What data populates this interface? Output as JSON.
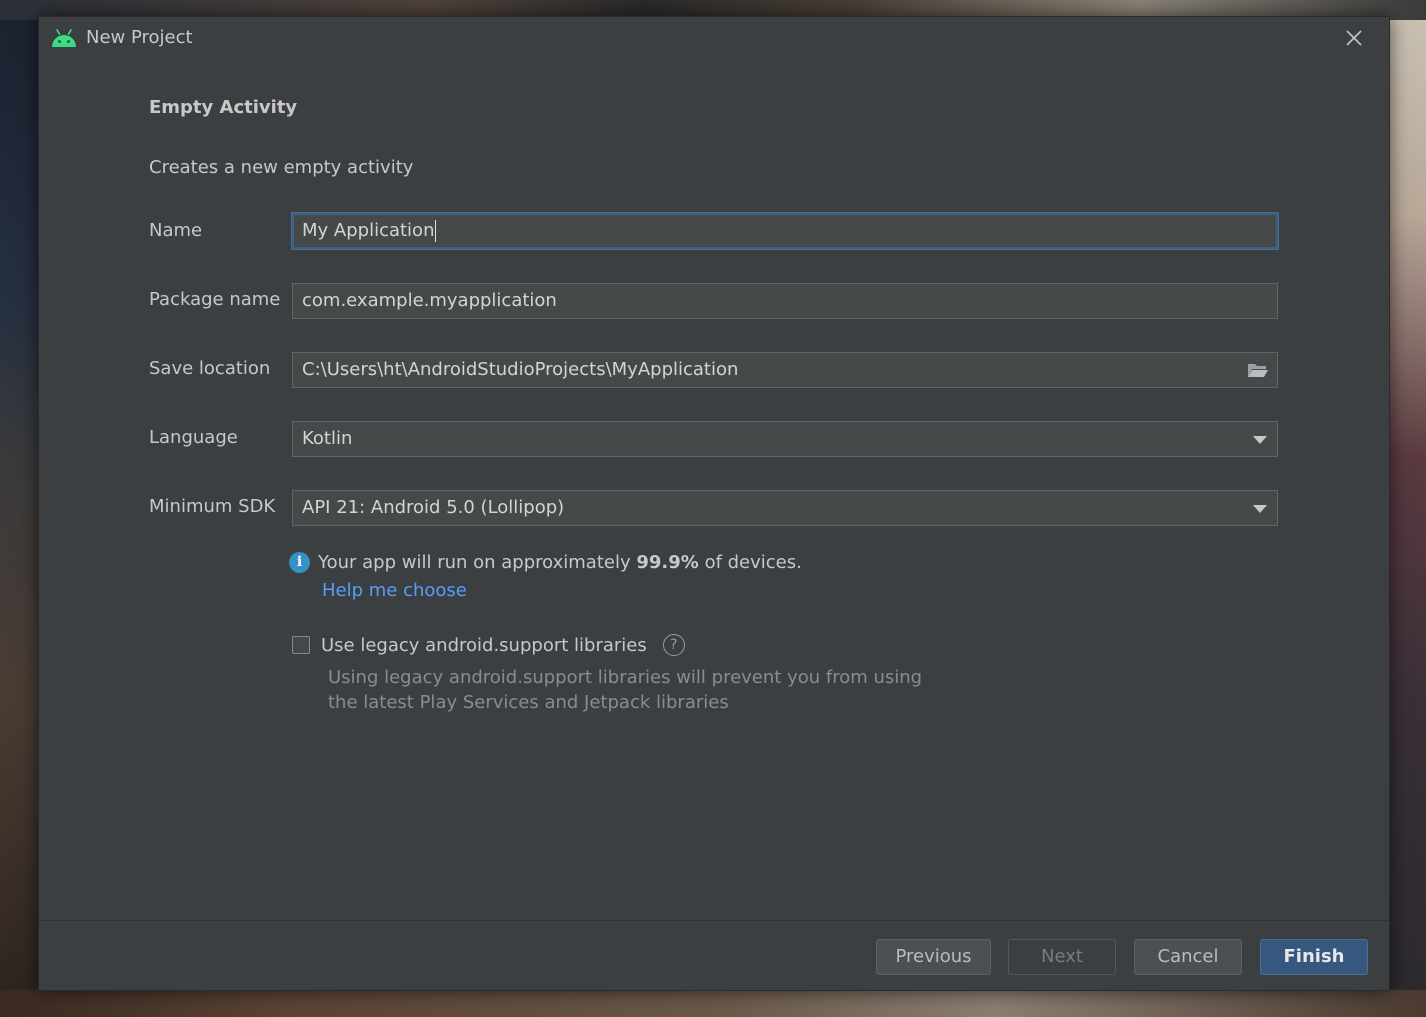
{
  "window": {
    "title": "New Project"
  },
  "template": {
    "heading": "Empty Activity",
    "description": "Creates a new empty activity"
  },
  "form": {
    "name_label": "Name",
    "name_value": "My Application",
    "package_label": "Package name",
    "package_value": "com.example.myapplication",
    "location_label": "Save location",
    "location_value": "C:\\Users\\ht\\AndroidStudioProjects\\MyApplication",
    "language_label": "Language",
    "language_value": "Kotlin",
    "sdk_label": "Minimum SDK",
    "sdk_value": "API 21: Android 5.0 (Lollipop)"
  },
  "info": {
    "prefix": "Your app will run on approximately",
    "percent": "99.9%",
    "suffix": "of devices.",
    "help_link": "Help me choose"
  },
  "legacy": {
    "label": "Use legacy android.support libraries",
    "checked": false,
    "description_line1": "Using legacy android.support libraries will prevent you from using",
    "description_line2": "the latest Play Services and Jetpack libraries"
  },
  "buttons": {
    "previous": "Previous",
    "next": "Next",
    "cancel": "Cancel",
    "finish": "Finish"
  },
  "icons": {
    "app": "android-icon",
    "close": "close-icon",
    "folder": "folder-icon",
    "info": "info-icon",
    "help": "help-icon"
  },
  "colors": {
    "dialog_bg": "#3c3f41",
    "accent": "#365880",
    "link": "#589df6",
    "android_green": "#3ddc84"
  }
}
